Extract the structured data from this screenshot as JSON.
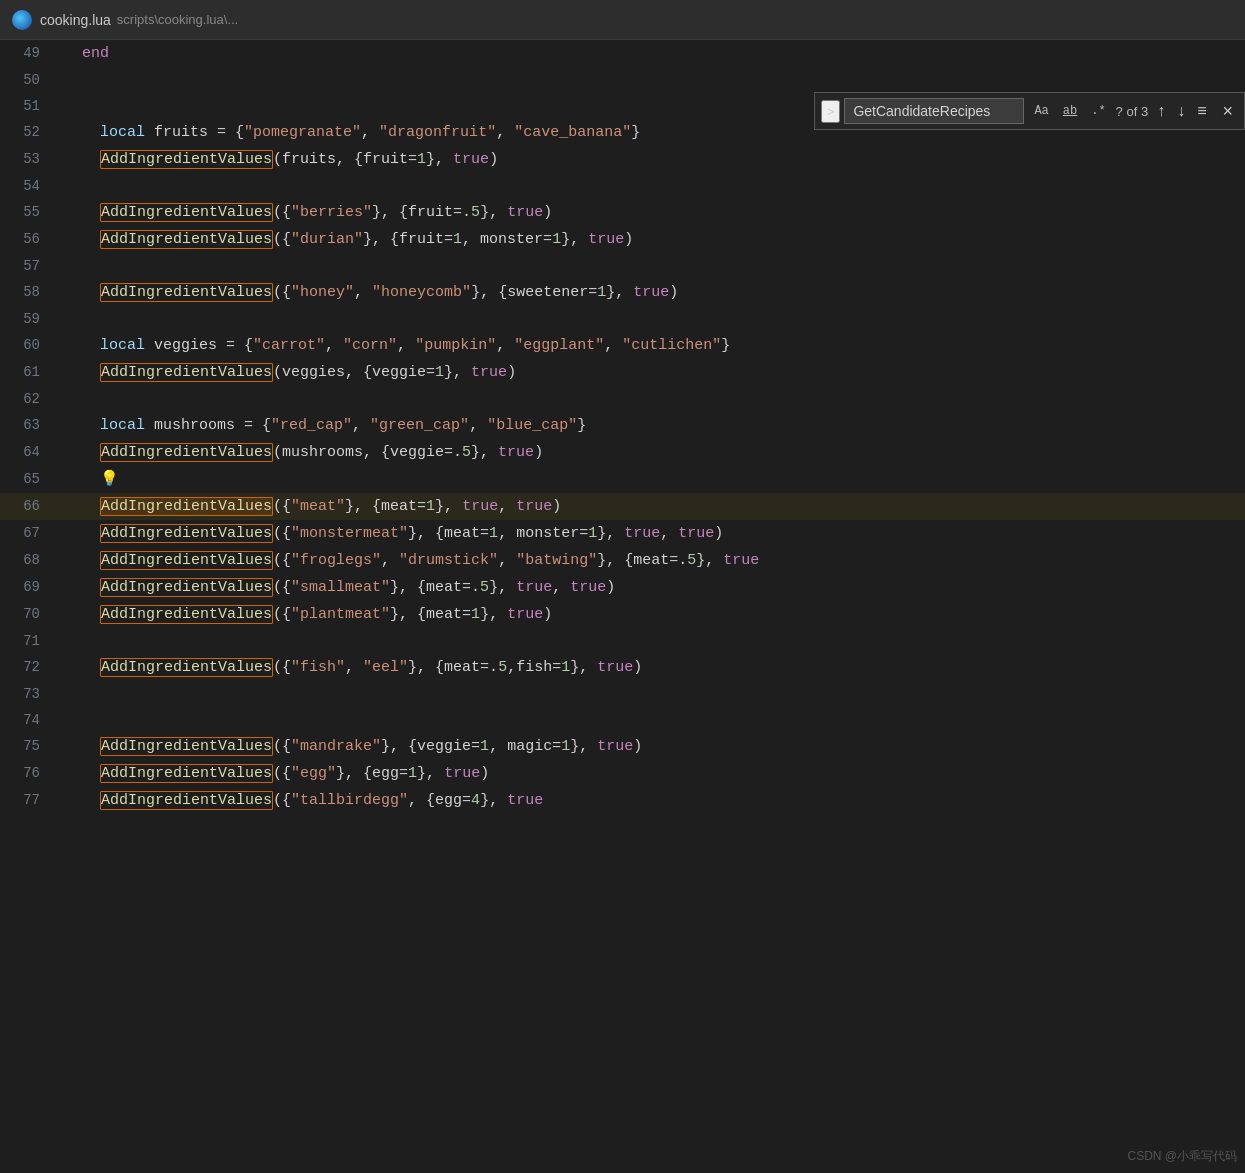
{
  "titlebar": {
    "filename": "cooking.lua",
    "path": "scripts\\cooking.lua\\..."
  },
  "search": {
    "placeholder": "GetCandidateRecipes",
    "value": "GetCandidateRecipes",
    "match_case_label": "Aa",
    "whole_word_label": "ab",
    "regex_label": ".*",
    "count_text": "? of 3",
    "expand_icon": ">",
    "prev_icon": "↑",
    "next_icon": "↓",
    "list_icon": "≡",
    "close_icon": "×"
  },
  "lines": [
    {
      "num": "49",
      "tokens": [
        {
          "t": "  end",
          "c": "end-kw"
        }
      ]
    },
    {
      "num": "50",
      "tokens": []
    },
    {
      "num": "51",
      "tokens": []
    },
    {
      "num": "52",
      "tokens": [
        {
          "t": "    ",
          "c": ""
        },
        {
          "t": "local",
          "c": "kw"
        },
        {
          "t": " fruits = {",
          "c": "white"
        },
        {
          "t": "\"pomegranate\"",
          "c": "str"
        },
        {
          "t": ", ",
          "c": "white"
        },
        {
          "t": "\"dragonfruit\"",
          "c": "str"
        },
        {
          "t": ", ",
          "c": "white"
        },
        {
          "t": "\"cave_banana\"",
          "c": "str"
        },
        {
          "t": "}",
          "c": "white"
        }
      ]
    },
    {
      "num": "53",
      "tokens": [
        {
          "t": "    ",
          "c": ""
        },
        {
          "t": "AddIngredientValues",
          "c": "fn-highlight"
        },
        {
          "t": "(fruits, {fruit=",
          "c": "white"
        },
        {
          "t": "1",
          "c": "num"
        },
        {
          "t": "}, ",
          "c": "white"
        },
        {
          "t": "true",
          "c": "key"
        },
        {
          "t": ")",
          "c": "white"
        }
      ]
    },
    {
      "num": "54",
      "tokens": []
    },
    {
      "num": "55",
      "tokens": [
        {
          "t": "    ",
          "c": ""
        },
        {
          "t": "AddIngredientValues",
          "c": "fn-highlight"
        },
        {
          "t": "({",
          "c": "white"
        },
        {
          "t": "\"berries\"",
          "c": "str"
        },
        {
          "t": "}, {fruit=.",
          "c": "white"
        },
        {
          "t": "5",
          "c": "num"
        },
        {
          "t": "}, ",
          "c": "white"
        },
        {
          "t": "true",
          "c": "key"
        },
        {
          "t": ")",
          "c": "white"
        }
      ]
    },
    {
      "num": "56",
      "tokens": [
        {
          "t": "    ",
          "c": ""
        },
        {
          "t": "AddIngredientValues",
          "c": "fn-highlight"
        },
        {
          "t": "({",
          "c": "white"
        },
        {
          "t": "\"durian\"",
          "c": "str"
        },
        {
          "t": "}, {fruit=",
          "c": "white"
        },
        {
          "t": "1",
          "c": "num"
        },
        {
          "t": ", monster=",
          "c": "white"
        },
        {
          "t": "1",
          "c": "num"
        },
        {
          "t": "}, ",
          "c": "white"
        },
        {
          "t": "true",
          "c": "key"
        },
        {
          "t": ")",
          "c": "white"
        }
      ]
    },
    {
      "num": "57",
      "tokens": []
    },
    {
      "num": "58",
      "tokens": [
        {
          "t": "    ",
          "c": ""
        },
        {
          "t": "AddIngredientValues",
          "c": "fn-highlight"
        },
        {
          "t": "({",
          "c": "white"
        },
        {
          "t": "\"honey\"",
          "c": "str"
        },
        {
          "t": ", ",
          "c": "white"
        },
        {
          "t": "\"honeycomb\"",
          "c": "str"
        },
        {
          "t": "}, {sweetener=",
          "c": "white"
        },
        {
          "t": "1",
          "c": "num"
        },
        {
          "t": "}, ",
          "c": "white"
        },
        {
          "t": "true",
          "c": "key"
        },
        {
          "t": ")",
          "c": "white"
        }
      ]
    },
    {
      "num": "59",
      "tokens": []
    },
    {
      "num": "60",
      "tokens": [
        {
          "t": "    ",
          "c": ""
        },
        {
          "t": "local",
          "c": "kw"
        },
        {
          "t": " veggies = {",
          "c": "white"
        },
        {
          "t": "\"carrot\"",
          "c": "str"
        },
        {
          "t": ", ",
          "c": "white"
        },
        {
          "t": "\"corn\"",
          "c": "str"
        },
        {
          "t": ", ",
          "c": "white"
        },
        {
          "t": "\"pumpkin\"",
          "c": "str"
        },
        {
          "t": ", ",
          "c": "white"
        },
        {
          "t": "\"eggplant\"",
          "c": "str"
        },
        {
          "t": ", ",
          "c": "white"
        },
        {
          "t": "\"cutlichen\"",
          "c": "str"
        },
        {
          "t": "}",
          "c": "white"
        }
      ]
    },
    {
      "num": "61",
      "tokens": [
        {
          "t": "    ",
          "c": ""
        },
        {
          "t": "AddIngredientValues",
          "c": "fn-highlight"
        },
        {
          "t": "(veggies, {veggie=",
          "c": "white"
        },
        {
          "t": "1",
          "c": "num"
        },
        {
          "t": "}, ",
          "c": "white"
        },
        {
          "t": "true",
          "c": "key"
        },
        {
          "t": ")",
          "c": "white"
        }
      ]
    },
    {
      "num": "62",
      "tokens": []
    },
    {
      "num": "63",
      "tokens": [
        {
          "t": "    ",
          "c": ""
        },
        {
          "t": "local",
          "c": "kw"
        },
        {
          "t": " mushrooms = {",
          "c": "white"
        },
        {
          "t": "\"red_cap\"",
          "c": "str"
        },
        {
          "t": ", ",
          "c": "white"
        },
        {
          "t": "\"green_cap\"",
          "c": "str"
        },
        {
          "t": ", ",
          "c": "white"
        },
        {
          "t": "\"blue_cap\"",
          "c": "str"
        },
        {
          "t": "}",
          "c": "white"
        }
      ]
    },
    {
      "num": "64",
      "tokens": [
        {
          "t": "    ",
          "c": ""
        },
        {
          "t": "AddIngredientValues",
          "c": "fn-highlight"
        },
        {
          "t": "(mushrooms, {veggie=.",
          "c": "white"
        },
        {
          "t": "5",
          "c": "num"
        },
        {
          "t": "}, ",
          "c": "white"
        },
        {
          "t": "true",
          "c": "key"
        },
        {
          "t": ")",
          "c": "white"
        }
      ]
    },
    {
      "num": "65",
      "tokens": [
        {
          "t": "    💡",
          "c": "white"
        }
      ]
    },
    {
      "num": "66",
      "tokens": [
        {
          "t": "    ",
          "c": ""
        },
        {
          "t": "AddIngredientValues",
          "c": "fn-highlight-active"
        },
        {
          "t": "({",
          "c": "white"
        },
        {
          "t": "\"meat\"",
          "c": "str"
        },
        {
          "t": "}, {meat=",
          "c": "white"
        },
        {
          "t": "1",
          "c": "num"
        },
        {
          "t": "}, ",
          "c": "white"
        },
        {
          "t": "true",
          "c": "key"
        },
        {
          "t": ", ",
          "c": "white"
        },
        {
          "t": "true",
          "c": "key"
        },
        {
          "t": ")",
          "c": "white"
        }
      ],
      "active": true
    },
    {
      "num": "67",
      "tokens": [
        {
          "t": "    ",
          "c": ""
        },
        {
          "t": "AddIngredientValues",
          "c": "fn-highlight"
        },
        {
          "t": "({",
          "c": "white"
        },
        {
          "t": "\"monstermeat\"",
          "c": "str"
        },
        {
          "t": "}, {meat=",
          "c": "white"
        },
        {
          "t": "1",
          "c": "num"
        },
        {
          "t": ", monster=",
          "c": "white"
        },
        {
          "t": "1",
          "c": "num"
        },
        {
          "t": "}, ",
          "c": "white"
        },
        {
          "t": "true",
          "c": "key"
        },
        {
          "t": ", ",
          "c": "white"
        },
        {
          "t": "true",
          "c": "key"
        },
        {
          "t": ")",
          "c": "white"
        }
      ]
    },
    {
      "num": "68",
      "tokens": [
        {
          "t": "    ",
          "c": ""
        },
        {
          "t": "AddIngredientValues",
          "c": "fn-highlight"
        },
        {
          "t": "({",
          "c": "white"
        },
        {
          "t": "\"froglegs\"",
          "c": "str"
        },
        {
          "t": ", ",
          "c": "white"
        },
        {
          "t": "\"drumstick\"",
          "c": "str"
        },
        {
          "t": ", ",
          "c": "white"
        },
        {
          "t": "\"batwing\"",
          "c": "str"
        },
        {
          "t": "}, {meat=.",
          "c": "white"
        },
        {
          "t": "5",
          "c": "num"
        },
        {
          "t": "}, ",
          "c": "white"
        },
        {
          "t": "true",
          "c": "key"
        }
      ]
    },
    {
      "num": "69",
      "tokens": [
        {
          "t": "    ",
          "c": ""
        },
        {
          "t": "AddIngredientValues",
          "c": "fn-highlight"
        },
        {
          "t": "({",
          "c": "white"
        },
        {
          "t": "\"smallmeat\"",
          "c": "str"
        },
        {
          "t": "}, {meat=.",
          "c": "white"
        },
        {
          "t": "5",
          "c": "num"
        },
        {
          "t": "}, ",
          "c": "white"
        },
        {
          "t": "true",
          "c": "key"
        },
        {
          "t": ", ",
          "c": "white"
        },
        {
          "t": "true",
          "c": "key"
        },
        {
          "t": ")",
          "c": "white"
        }
      ]
    },
    {
      "num": "70",
      "tokens": [
        {
          "t": "    ",
          "c": ""
        },
        {
          "t": "AddIngredientValues",
          "c": "fn-highlight"
        },
        {
          "t": "({",
          "c": "white"
        },
        {
          "t": "\"plantmeat\"",
          "c": "str"
        },
        {
          "t": "}, {meat=",
          "c": "white"
        },
        {
          "t": "1",
          "c": "num"
        },
        {
          "t": "}, ",
          "c": "white"
        },
        {
          "t": "true",
          "c": "key"
        },
        {
          "t": ")",
          "c": "white"
        }
      ]
    },
    {
      "num": "71",
      "tokens": []
    },
    {
      "num": "72",
      "tokens": [
        {
          "t": "    ",
          "c": ""
        },
        {
          "t": "AddIngredientValues",
          "c": "fn-highlight"
        },
        {
          "t": "({",
          "c": "white"
        },
        {
          "t": "\"fish\"",
          "c": "str"
        },
        {
          "t": ", ",
          "c": "white"
        },
        {
          "t": "\"eel\"",
          "c": "str"
        },
        {
          "t": "}, {meat=.",
          "c": "white"
        },
        {
          "t": "5",
          "c": "num"
        },
        {
          "t": ",fish=",
          "c": "white"
        },
        {
          "t": "1",
          "c": "num"
        },
        {
          "t": "}, ",
          "c": "white"
        },
        {
          "t": "true",
          "c": "key"
        },
        {
          "t": ")",
          "c": "white"
        }
      ]
    },
    {
      "num": "73",
      "tokens": []
    },
    {
      "num": "74",
      "tokens": []
    },
    {
      "num": "75",
      "tokens": [
        {
          "t": "    ",
          "c": ""
        },
        {
          "t": "AddIngredientValues",
          "c": "fn-highlight"
        },
        {
          "t": "({",
          "c": "white"
        },
        {
          "t": "\"mandrake\"",
          "c": "str"
        },
        {
          "t": "}, {veggie=",
          "c": "white"
        },
        {
          "t": "1",
          "c": "num"
        },
        {
          "t": ", magic=",
          "c": "white"
        },
        {
          "t": "1",
          "c": "num"
        },
        {
          "t": "}, ",
          "c": "white"
        },
        {
          "t": "true",
          "c": "key"
        },
        {
          "t": ")",
          "c": "white"
        }
      ]
    },
    {
      "num": "76",
      "tokens": [
        {
          "t": "    ",
          "c": ""
        },
        {
          "t": "AddIngredientValues",
          "c": "fn-highlight"
        },
        {
          "t": "({",
          "c": "white"
        },
        {
          "t": "\"egg\"",
          "c": "str"
        },
        {
          "t": "}, {egg=",
          "c": "white"
        },
        {
          "t": "1",
          "c": "num"
        },
        {
          "t": "}, ",
          "c": "white"
        },
        {
          "t": "true",
          "c": "key"
        },
        {
          "t": ")",
          "c": "white"
        }
      ]
    },
    {
      "num": "77",
      "tokens": [
        {
          "t": "    ",
          "c": ""
        },
        {
          "t": "AddIngredientValues",
          "c": "fn-highlight"
        },
        {
          "t": "({",
          "c": "white"
        },
        {
          "t": "\"tallbirdegg\"",
          "c": "str"
        },
        {
          "t": ", {egg=",
          "c": "white"
        },
        {
          "t": "4",
          "c": "num"
        },
        {
          "t": "}, ",
          "c": "white"
        },
        {
          "t": "true",
          "c": "key"
        }
      ]
    }
  ],
  "watermark": "CSDN @小乖写代码"
}
